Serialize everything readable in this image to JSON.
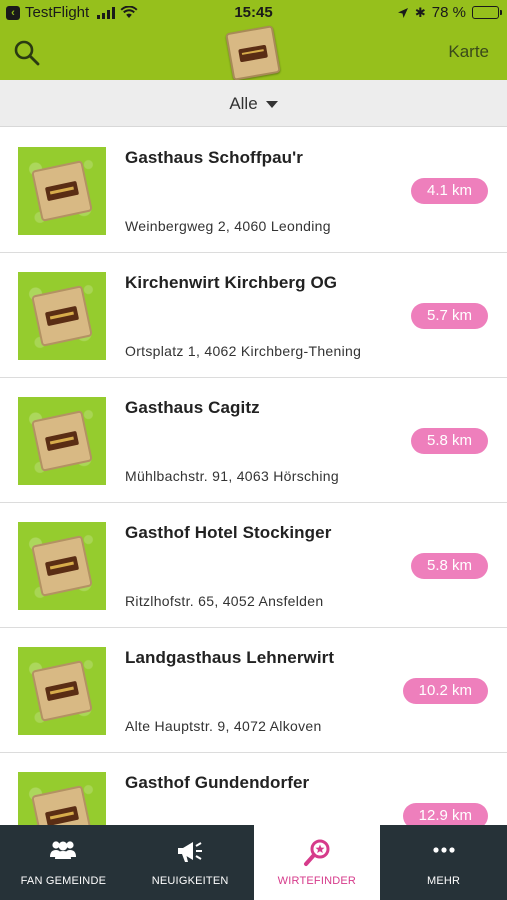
{
  "status_bar": {
    "app_name": "TestFlight",
    "time": "15:45",
    "bluetooth": "✱",
    "battery_percent": "78 %",
    "battery_level": 0.78
  },
  "nav": {
    "map_label": "Karte"
  },
  "filter": {
    "label": "Alle"
  },
  "restaurants": [
    {
      "name": "Gasthaus Schoffpau'r",
      "address": "Weinbergweg 2, 4060 Leonding",
      "distance": "4.1 km"
    },
    {
      "name": "Kirchenwirt Kirchberg OG",
      "address": "Ortsplatz 1, 4062 Kirchberg-Thening",
      "distance": "5.7 km"
    },
    {
      "name": "Gasthaus Cagitz",
      "address": "Mühlbachstr. 91, 4063 Hörsching",
      "distance": "5.8 km"
    },
    {
      "name": "Gasthof Hotel Stockinger",
      "address": "Ritzlhofstr. 65, 4052 Ansfelden",
      "distance": "5.8 km"
    },
    {
      "name": "Landgasthaus Lehnerwirt",
      "address": "Alte Hauptstr. 9, 4072 Alkoven",
      "distance": "10.2 km"
    },
    {
      "name": "Gasthof Gundendorfer",
      "address": "",
      "distance": "12.9 km"
    }
  ],
  "tabs": [
    {
      "label": "FAN GEMEINDE",
      "icon": "people-icon"
    },
    {
      "label": "NEUIGKEITEN",
      "icon": "megaphone-icon"
    },
    {
      "label": "WIRTEFINDER",
      "icon": "magnifier-star-icon",
      "active": true
    },
    {
      "label": "MEHR",
      "icon": "more-dots-icon"
    }
  ],
  "colors": {
    "brand_green": "#96c01c",
    "distance_pink": "#ee7fbc",
    "active_tab_magenta": "#d63b8b",
    "tabbar_dark": "#263238"
  }
}
